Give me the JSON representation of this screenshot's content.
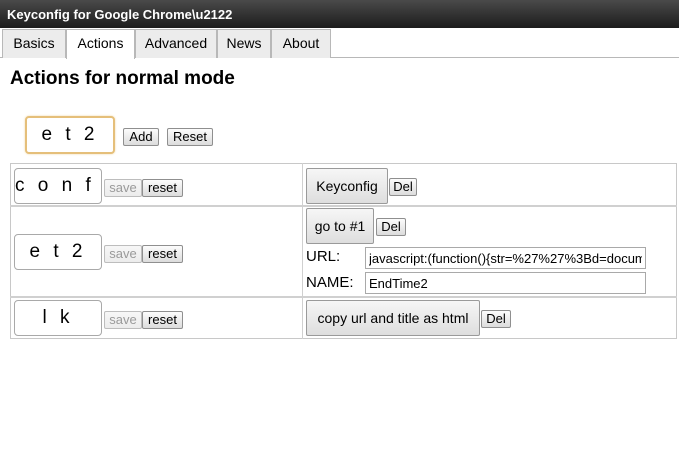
{
  "window": {
    "title": "Keyconfig for Google Chrome\\u2122"
  },
  "tabs": [
    {
      "label": "Basics"
    },
    {
      "label": "Actions",
      "active": true
    },
    {
      "label": "Advanced"
    },
    {
      "label": "News"
    },
    {
      "label": "About"
    }
  ],
  "heading": "Actions for normal mode",
  "new_binding": {
    "key": "e t 2",
    "add_label": "Add",
    "reset_label": "Reset"
  },
  "rows": [
    {
      "key": "c o n f i g",
      "save_label": "save",
      "reset_label": "reset",
      "action_label": "Keyconfig",
      "del_label": "Del"
    },
    {
      "key": "e t 2",
      "save_label": "save",
      "reset_label": "reset",
      "action_label": "go to #1",
      "del_label": "Del",
      "url_label": "URL:",
      "url_value": "javascript:(function(){str=%27%27%3Bd=docum",
      "name_label": "NAME:",
      "name_value": "EndTime2"
    },
    {
      "key": "l k",
      "save_label": "save",
      "reset_label": "reset",
      "action_label": "copy url and title as html",
      "del_label": "Del"
    }
  ]
}
